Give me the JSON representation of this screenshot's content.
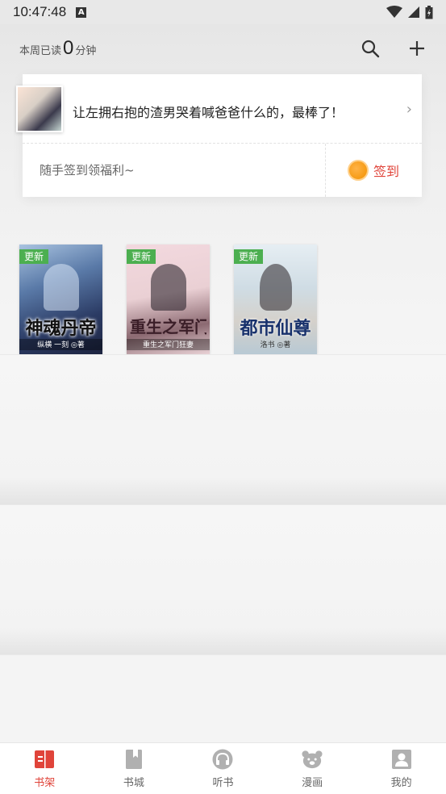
{
  "status_bar": {
    "time": "10:47:48",
    "notification_letter": "A"
  },
  "header": {
    "reading_prefix": "本周已读",
    "reading_minutes": "0",
    "reading_suffix": "分钟"
  },
  "recommend_card": {
    "quote": "让左拥右抱的渣男哭着喊爸爸什么的，最棒了！",
    "checkin_prompt": "随手签到领福利~",
    "checkin_button": "签到"
  },
  "books": [
    {
      "title": "神魂丹帝",
      "badge": "更新",
      "author": "纵横 一刻 ◎著"
    },
    {
      "title": "重生之军门狂妻",
      "badge": "更新",
      "author": "重生之军门狂妻"
    },
    {
      "title": "都市仙尊",
      "badge": "更新",
      "author": "洛书 ◎著"
    }
  ],
  "bottom_nav": [
    {
      "label": "书架",
      "icon": "bookshelf-icon",
      "active": true
    },
    {
      "label": "书城",
      "icon": "bookstore-icon",
      "active": false
    },
    {
      "label": "听书",
      "icon": "headphones-icon",
      "active": false
    },
    {
      "label": "漫画",
      "icon": "bear-icon",
      "active": false
    },
    {
      "label": "我的",
      "icon": "profile-icon",
      "active": false
    }
  ],
  "colors": {
    "accent": "#e0443a",
    "badge": "#4caf50",
    "inactive_icon": "#b0b0b0"
  }
}
